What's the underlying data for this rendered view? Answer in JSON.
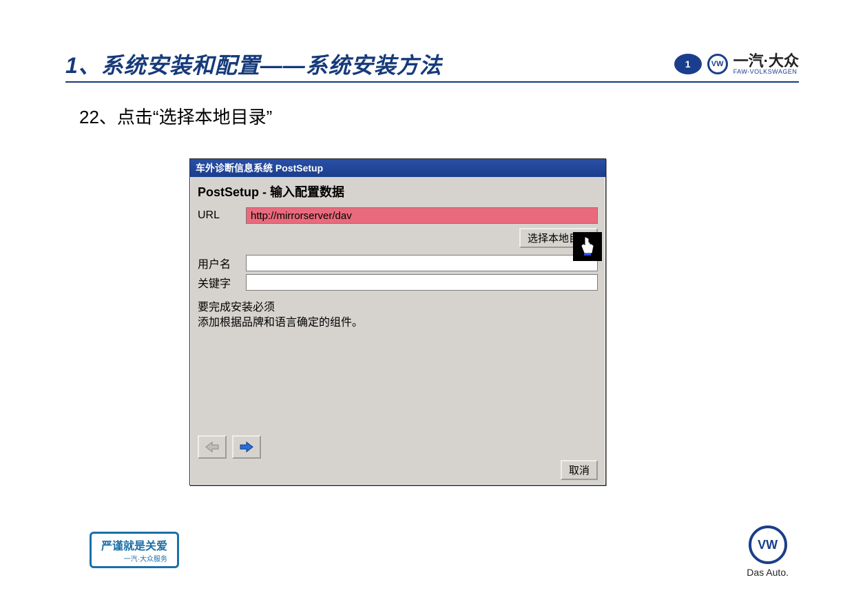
{
  "header": {
    "title": "1、系统安装和配置——系统安装方法",
    "brand_cn": "一汽·大众",
    "brand_en": "FAW-VOLKSWAGEN"
  },
  "step": "22、点击“选择本地目录”",
  "dialog": {
    "titlebar": "车外诊断信息系统 PostSetup",
    "subtitle": "PostSetup - 输入配置数据",
    "url_label": "URL",
    "url_value": "http://mirrorserver/dav",
    "select_dir_btn": "选择本地目录",
    "username_label": "用户名",
    "username_value": "",
    "keyword_label": "关键字",
    "keyword_value": "",
    "info_line1": "要完成安装必须",
    "info_line2": "添加根据品牌和语言确定的组件。",
    "cancel_btn": "取消"
  },
  "footer": {
    "badge_main": "严谨就是关爱",
    "badge_sub": "一汽·大众服务",
    "das_auto": "Das Auto."
  }
}
